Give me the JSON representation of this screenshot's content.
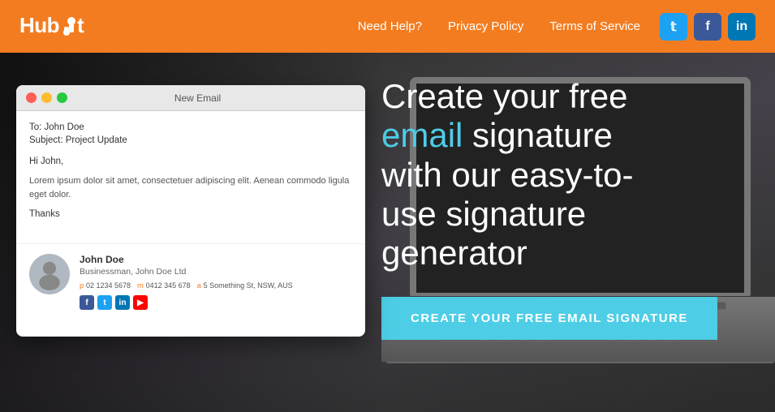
{
  "header": {
    "logo": "HubSpot",
    "nav": {
      "help": "Need Help?",
      "privacy": "Privacy Policy",
      "terms": "Terms of Service"
    },
    "social": {
      "twitter": "t",
      "facebook": "f",
      "linkedin": "in"
    }
  },
  "hero": {
    "title_line1": "Create your free",
    "title_line2": "email",
    "title_line3": "signature",
    "title_line4": "with our easy-to-",
    "title_line5": "use signature",
    "title_line6": "generator",
    "cta_button": "CREATE YOUR FREE EMAIL SIGNATURE"
  },
  "email_window": {
    "title": "New Email",
    "to": "To:  John Doe",
    "subject": "Subject:  Project Update",
    "greeting": "Hi John,",
    "body": "Lorem ipsum dolor sit amet, consectetuer adipiscing elit. Aenean commodo ligula eget dolor.",
    "thanks": "Thanks",
    "signature": {
      "name": "John Doe",
      "title": "Businessman, John Doe Ltd",
      "phone_label": "p",
      "phone": "02 1234 5678",
      "mobile_label": "m",
      "mobile": "0412 345 678",
      "address_label": "a",
      "address": "5 Something St, NSW, AUS"
    }
  }
}
